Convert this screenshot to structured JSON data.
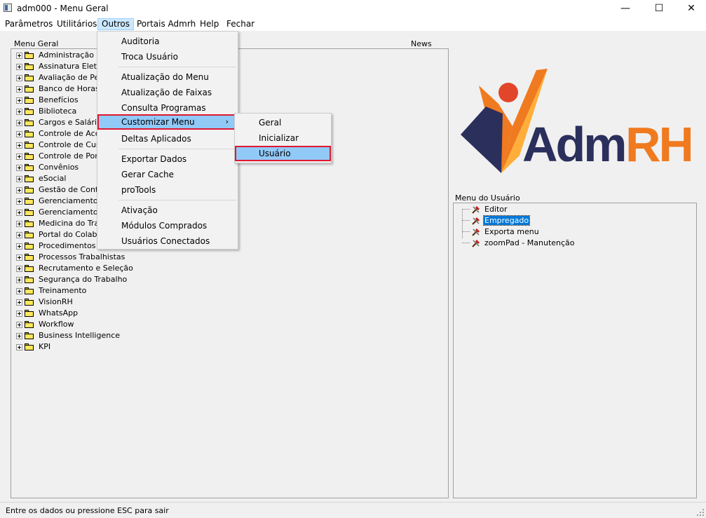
{
  "window": {
    "title": "adm000 - Menu Geral",
    "minimize_glyph": "—",
    "maximize_glyph": "☐",
    "close_glyph": "✕"
  },
  "menubar": {
    "items": [
      "Parâmetros",
      "Utilitários",
      "Outros",
      "Portais Admrh",
      "Help",
      "Fechar"
    ]
  },
  "menu_geral": {
    "label": "Menu Geral",
    "items": [
      "Administração",
      "Assinatura Eletrô",
      "Avaliação de Pe",
      "Banco de Horas",
      "Benefícios",
      "Biblioteca",
      "Cargos e Salário",
      "Controle de Aces",
      "Controle de Cust",
      "Controle de Pont",
      "Convênios",
      "eSocial",
      "Gestão de Contra",
      "Gerenciamento d",
      "Gerenciamento E",
      "Medicina do Trab",
      "Portal do Colabo",
      "Procedimentos",
      "Processos Trabalhistas",
      "Recrutamento e Seleção",
      "Segurança do Trabalho",
      "Treinamento",
      "VisionRH",
      "WhatsApp",
      "Workflow",
      "Business Intelligence",
      "KPI"
    ]
  },
  "news": {
    "label": "News",
    "logo_text_adm": "Adm",
    "logo_text_rh": "RH",
    "logo_colors": {
      "navy": "#2b2f5c",
      "orange": "#f07a1f",
      "red": "#e2462a"
    }
  },
  "outros_menu": {
    "items": [
      "Auditoria",
      "Troca Usuário",
      "Atualização do Menu",
      "Atualização de Faixas",
      "Consulta Programas",
      "Customizar Menu",
      "Deltas Aplicados",
      "Exportar Dados",
      "Gerar Cache",
      "proTools",
      "Ativação",
      "Módulos Comprados",
      "Usuários Conectados"
    ],
    "submenu_arrow": "›"
  },
  "customizar_submenu": {
    "items": [
      "Geral",
      "Inicializar",
      "Usuário"
    ]
  },
  "menu_usuario": {
    "label": "Menu do Usuário",
    "items": [
      "Editor",
      "Empregado",
      "Exporta menu",
      "zoomPad - Manutenção"
    ]
  },
  "status": {
    "text": "Entre os dados ou pressione ESC para sair"
  },
  "colors": {
    "highlight": "#91c9f7",
    "highlight_border": "#e0182f",
    "selection": "#0078d7"
  }
}
